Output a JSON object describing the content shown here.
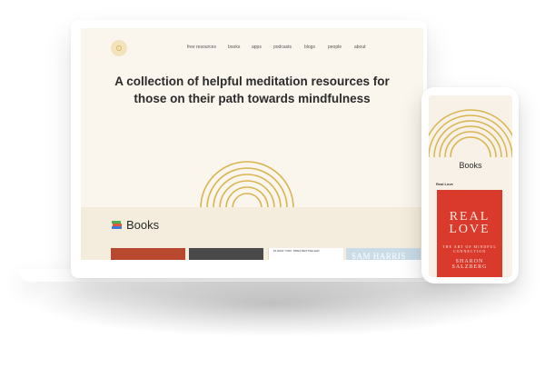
{
  "colors": {
    "accent_gold": "#d9b54f",
    "page_cream": "#faf5ed",
    "band_cream": "#f4ecdc",
    "book_red": "#d93a2c",
    "text_dark": "#2b2b2b"
  },
  "desktop": {
    "logo_icon": "circle-logo-icon",
    "nav": [
      "free resources",
      "books",
      "apps",
      "podcasts",
      "blogs",
      "people",
      "about"
    ],
    "hero": {
      "line1": "A collection of helpful meditation resources for",
      "line2": "those on their path towards mindfulness"
    },
    "books_section": {
      "emoji_icon": "books-icon",
      "title": "Books",
      "thumbnails": [
        {
          "caption": ""
        },
        {
          "caption": ""
        },
        {
          "caption": "#1 NEW YORK TIMES BESTSELLER"
        },
        {
          "caption": "SAM HARRIS"
        }
      ]
    }
  },
  "mobile": {
    "section_title": "Books",
    "book_label": "Real Love",
    "cover": {
      "title_line1": "REAL",
      "title_line2": "LOVE",
      "subtitle": "THE ART OF MINDFUL CONNECTION",
      "author": "SHARON SALZBERG"
    }
  }
}
